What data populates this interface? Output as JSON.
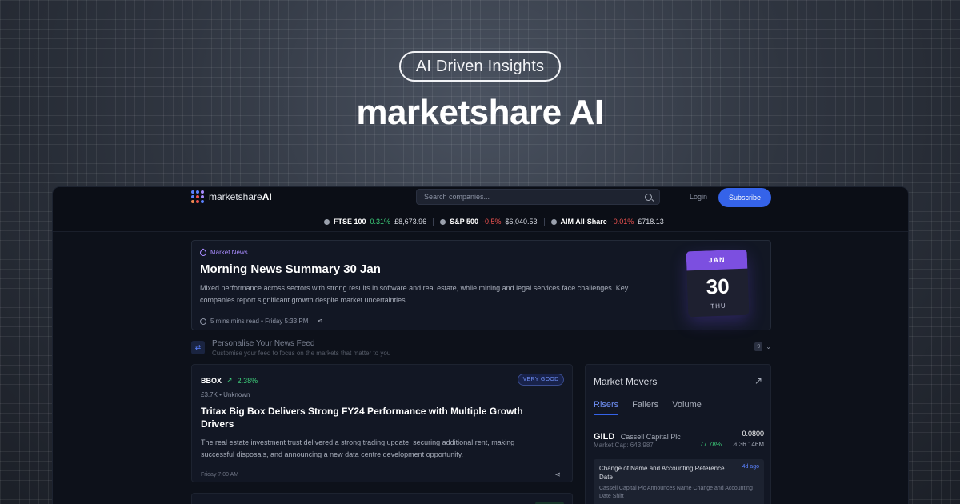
{
  "hero": {
    "badge": "AI Driven Insights",
    "title": "marketshare AI"
  },
  "header": {
    "logo_text": "marketshare",
    "logo_bold": "AI",
    "search_placeholder": "Search companies...",
    "login_label": "Login",
    "subscribe_label": "Subscribe"
  },
  "ticker": [
    {
      "name": "FTSE 100",
      "change": "0.31%",
      "value": "£8,673.96",
      "direction": "up"
    },
    {
      "name": "S&P 500",
      "change": "-0.5%",
      "value": "$6,040.53",
      "direction": "down"
    },
    {
      "name": "AIM All-Share",
      "change": "-0.01%",
      "value": "£718.13",
      "direction": "down"
    }
  ],
  "featured": {
    "tag": "Market News",
    "title": "Morning News Summary 30 Jan",
    "description": "Mixed performance across sectors with strong results in software and real estate, while mining and legal services face challenges. Key companies report significant growth despite market uncertainties.",
    "meta": "5 mins mins read • Friday 5:33 PM",
    "calendar": {
      "month": "JAN",
      "day": "30",
      "weekday": "THU"
    }
  },
  "personalise": {
    "title": "Personalise Your News Feed",
    "subtitle": "Customise your feed to focus on the markets that matter to you",
    "count": "9"
  },
  "article": {
    "symbol": "BBOX",
    "change": "2.38%",
    "sub": "£3.7K • Unknown",
    "badge": "VERY GOOD",
    "title": "Tritax Big Box Delivers Strong FY24 Performance with Multiple Growth Drivers",
    "description": "The real estate investment trust delivered a strong trading update, securing additional rent, making successful disposals, and announcing a new data centre development opportunity.",
    "date": "Friday 7:00 AM"
  },
  "movers": {
    "title": "Market Movers",
    "tabs": [
      "Risers",
      "Fallers",
      "Volume"
    ],
    "row": {
      "symbol": "GILD",
      "name": "Cassell Capital Plc",
      "price": "0.0800",
      "cap": "Market Cap: 643,987",
      "change": "77.78%",
      "volume": "36.146M"
    },
    "news": {
      "title": "Change of Name and Accounting Reference Date",
      "ago": "4d ago",
      "description": "Cassell Capital Plc Announces Name Change and Accounting Date Shift"
    }
  },
  "colors": {
    "accent": "#3563e9",
    "up": "#3ed17c",
    "down": "#ef5350",
    "tag": "#a98cff"
  },
  "icons": {
    "search": "search-icon",
    "share": "share-icon",
    "clock": "clock-icon",
    "arrow": "arrow-up-right-icon"
  }
}
